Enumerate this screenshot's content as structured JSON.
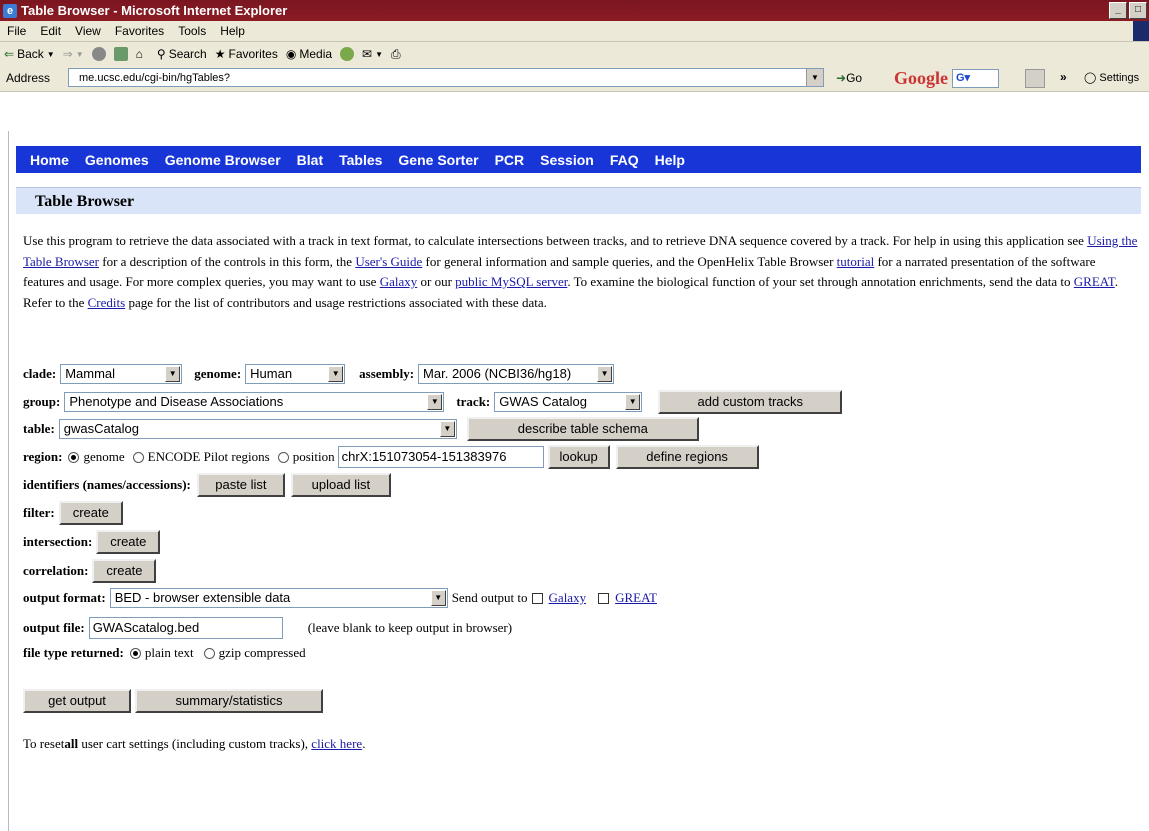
{
  "window": {
    "title": "Table Browser - Microsoft Internet Explorer",
    "menu": [
      "File",
      "Edit",
      "View",
      "Favorites",
      "Tools",
      "Help"
    ],
    "toolbar": {
      "back": "Back",
      "search": "Search",
      "favorites": "Favorites",
      "media": "Media"
    },
    "address_label": "Address",
    "address": "me.ucsc.edu/cgi-bin/hgTables?",
    "go": "Go",
    "google_logo": "Google",
    "google_field": "G▾",
    "settings": "Settings"
  },
  "nav": [
    "Home",
    "Genomes",
    "Genome Browser",
    "Blat",
    "Tables",
    "Gene Sorter",
    "PCR",
    "Session",
    "FAQ",
    "Help"
  ],
  "header": {
    "title": "Table Browser"
  },
  "intro": {
    "p1": "Use this program to retrieve the data associated with a track in text format, to calculate intersections between tracks, and to retrieve DNA sequence covered by a track. For help in using this application see ",
    "link_using": "Using the Table Browser",
    "p2": " for a description of the controls in this form, the ",
    "link_guide": "User's Guide",
    "p3": " for general information and sample queries, and the OpenHelix Table Browser ",
    "link_tutorial": "tutorial",
    "p4": " for a narrated presentation of the software features and usage. For more complex queries, you may want to use ",
    "link_galaxy": "Galaxy",
    "p5": " or our ",
    "link_mysql": "public MySQL server",
    "p6": ". To examine the biological function of your set through annotation enrichments, send the data to ",
    "link_great": "GREAT",
    "p7": ". Refer to the ",
    "link_credits": "Credits",
    "p8": " page for the list of contributors and usage restrictions associated with these data."
  },
  "form": {
    "clade_label": "clade:",
    "clade": "Mammal",
    "genome_label": "genome:",
    "genome": "Human",
    "assembly_label": "assembly:",
    "assembly": "Mar. 2006 (NCBI36/hg18)",
    "group_label": "group:",
    "group": "Phenotype and Disease Associations",
    "track_label": "track:",
    "track": "GWAS Catalog",
    "add_custom": "add custom tracks",
    "table_label": "table:",
    "table": "gwasCatalog",
    "describe": "describe table schema",
    "region_label": "region:",
    "region_genome": "genome",
    "region_encode": "ENCODE Pilot regions",
    "region_position": "position",
    "position_value": "chrX:151073054-151383976",
    "lookup": "lookup",
    "define_regions": "define regions",
    "identifiers_label": "identifiers (names/accessions):",
    "paste_list": "paste list",
    "upload_list": "upload list",
    "filter_label": "filter:",
    "filter_btn": "create",
    "intersection_label": "intersection:",
    "intersection_btn": "create",
    "correlation_label": "correlation:",
    "correlation_btn": "create",
    "output_format_label": "output format:",
    "output_format": "BED - browser extensible data",
    "send_output": "Send output to",
    "send_galaxy": "Galaxy",
    "send_great": "GREAT",
    "output_file_label": "output file:",
    "output_file": "GWAScatalog.bed",
    "output_file_hint": "(leave blank to keep output in browser)",
    "file_type_label": "file type returned:",
    "plain_text": "plain text",
    "gzip": "gzip compressed",
    "get_output": "get output",
    "summary": "summary/statistics"
  },
  "reset": {
    "pre": "To reset ",
    "bold": "all",
    "post": " user cart settings (including custom tracks), ",
    "link": "click here",
    "end": "."
  }
}
